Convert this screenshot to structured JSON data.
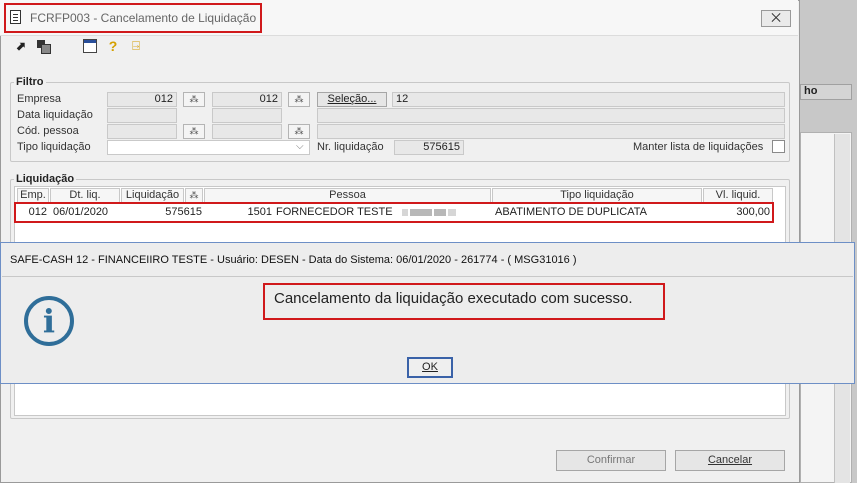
{
  "window": {
    "title": "FCRFP003 - Cancelamento de Liquidação",
    "close_glyph": "⨉"
  },
  "toolbar": {
    "arrow_glyph": "⬈",
    "help_glyph": "?",
    "exit_glyph": "⍈",
    "icons": [
      "arrow-icon",
      "stack-icon",
      "calendar-icon",
      "help-icon",
      "exit-door-icon"
    ]
  },
  "filtro": {
    "title": "Filtro",
    "empresa_label": "Empresa",
    "empresa_value": "012",
    "empresa2_value": "012",
    "selecao_label": "Seleção...",
    "selecao_value": "12",
    "data_liq_label": "Data liquidação",
    "cod_pessoa_label": "Cód. pessoa",
    "tipo_liq_label": "Tipo liquidação",
    "nr_liq_label": "Nr. liquidação",
    "nr_liq_value": "575615",
    "manter_label": "Manter lista de liquidações",
    "lookup_glyph": "⁂",
    "chevron_glyph": "⌵"
  },
  "liquidacao": {
    "title": "Liquidação",
    "columns": [
      "Emp.",
      "Dt. liq.",
      "Liquidação",
      "",
      "Pessoa",
      "Tipo liquidação",
      "Vl. liquid."
    ],
    "row": {
      "emp": "012",
      "dt_liq": "06/01/2020",
      "liquidacao": "575615",
      "pessoa_code": "1501",
      "pessoa_name": "FORNECEDOR TESTE",
      "tipo": "ABATIMENTO DE DUPLICATA",
      "valor": "300,00"
    }
  },
  "dialog": {
    "title": "SAFE-CASH 12 - FINANCEIIRO TESTE - Usuário: DESEN - Data do Sistema: 06/01/2020 - 261774 - ( MSG31016 )",
    "message": "Cancelamento da liquidação executado com sucesso.",
    "ok_label": "OK",
    "info_glyph": "i"
  },
  "buttons": {
    "confirmar": "Confirmar",
    "cancelar": "Cancelar"
  },
  "background_app": {
    "header_fragment": "ho"
  },
  "colors": {
    "highlight_red": "#d0191b",
    "info_blue": "#2f6e99",
    "dialog_border": "#6d8fc6"
  }
}
